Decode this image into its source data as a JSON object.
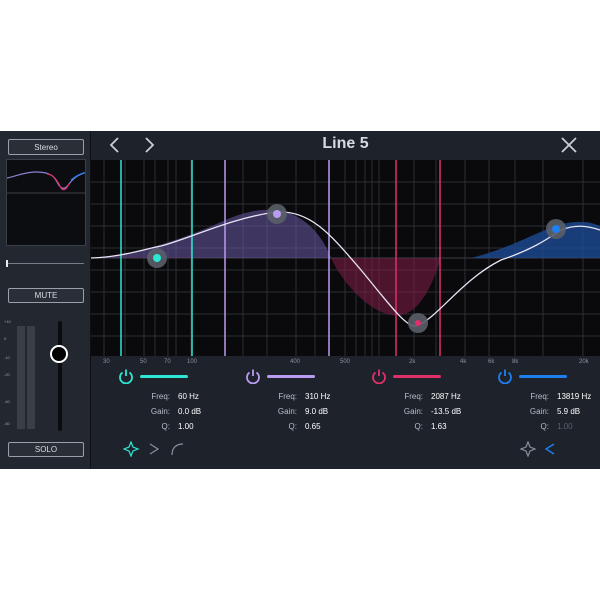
{
  "window": {
    "title": "Line 5"
  },
  "left_panel": {
    "stereo_label": "Stereo",
    "mute_label": "MUTE",
    "solo_label": "SOLO",
    "meter_scale": [
      "+10",
      "0",
      "-10",
      "-20",
      "-40",
      "-60"
    ]
  },
  "freq_axis": {
    "labels": [
      "30",
      "50",
      "70",
      "100",
      "400",
      "500",
      "2k",
      "4k",
      "6k",
      "8k",
      "20k"
    ]
  },
  "bands": [
    {
      "id": "band1",
      "color": "#2ee6d4",
      "freq_label": "Freq:",
      "freq": "60 Hz",
      "gain_label": "Gain:",
      "gain": "0.0 dB",
      "q_label": "Q:",
      "q": "1.00"
    },
    {
      "id": "band2",
      "color": "#b89cf0",
      "freq_label": "Freq:",
      "freq": "310 Hz",
      "gain_label": "Gain:",
      "gain": "9.0 dB",
      "q_label": "Q:",
      "q": "0.65"
    },
    {
      "id": "band3",
      "color": "#e0306a",
      "freq_label": "Freq:",
      "freq": "2087 Hz",
      "gain_label": "Gain:",
      "gain": "-13.5 dB",
      "q_label": "Q:",
      "q": "1.63"
    },
    {
      "id": "band4",
      "color": "#1e7ff0",
      "freq_label": "Freq:",
      "freq": "13819 Hz",
      "gain_label": "Gain:",
      "gain": "5.9 dB",
      "q_label": "Q:",
      "q": "1.00"
    }
  ],
  "filter_types": {
    "low": [
      "bell-icon",
      "low-shelf-icon",
      "high-pass-icon"
    ],
    "high": [
      "bell-icon",
      "high-shelf-icon"
    ]
  },
  "colors": {
    "accent_cyan": "#2ee6d4",
    "accent_purple": "#b89cf0",
    "accent_red": "#e0306a",
    "accent_blue": "#1e7ff0"
  }
}
